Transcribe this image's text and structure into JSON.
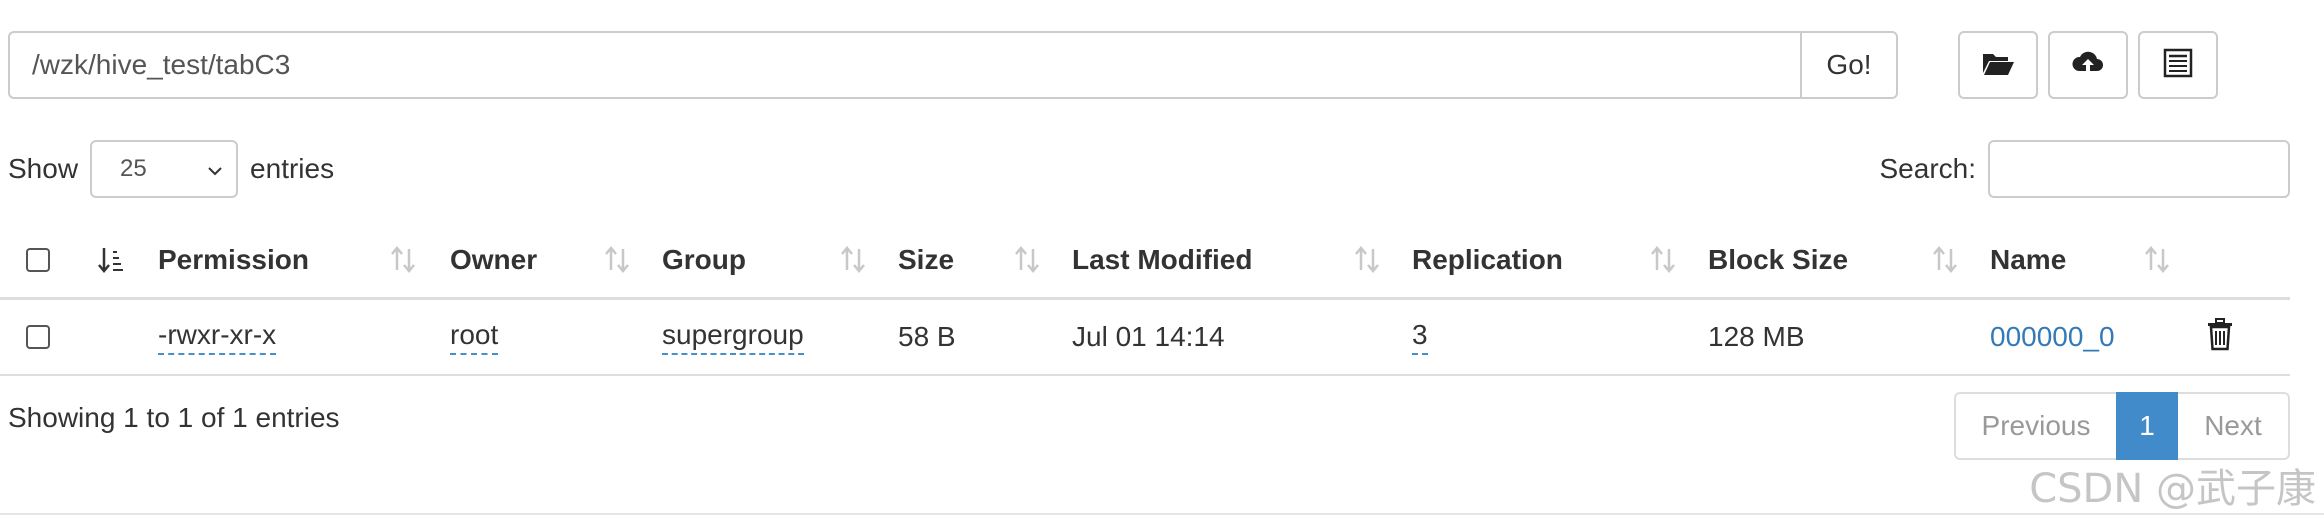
{
  "path_bar": {
    "path_value": "/wzk/hive_test/tabC3",
    "go_label": "Go!"
  },
  "toolbar": {
    "icons": [
      "folder-open-icon",
      "cloud-upload-icon",
      "list-icon"
    ]
  },
  "length_control": {
    "show_label": "Show",
    "selected": "25",
    "entries_label": "entries"
  },
  "search": {
    "label": "Search:",
    "value": ""
  },
  "table": {
    "columns": [
      "Permission",
      "Owner",
      "Group",
      "Size",
      "Last Modified",
      "Replication",
      "Block Size",
      "Name"
    ],
    "rows": [
      {
        "permission": "-rwxr-xr-x",
        "owner": "root",
        "group": "supergroup",
        "size": "58 B",
        "last_modified": "Jul 01 14:14",
        "replication": "3",
        "block_size": "128 MB",
        "name": "000000_0"
      }
    ]
  },
  "footer": {
    "info": "Showing 1 to 1 of 1 entries",
    "previous_label": "Previous",
    "current_page": "1",
    "next_label": "Next"
  },
  "watermark": "CSDN @武子康",
  "colors": {
    "accent": "#428bca",
    "link": "#337ab7",
    "border": "#cccccc"
  }
}
